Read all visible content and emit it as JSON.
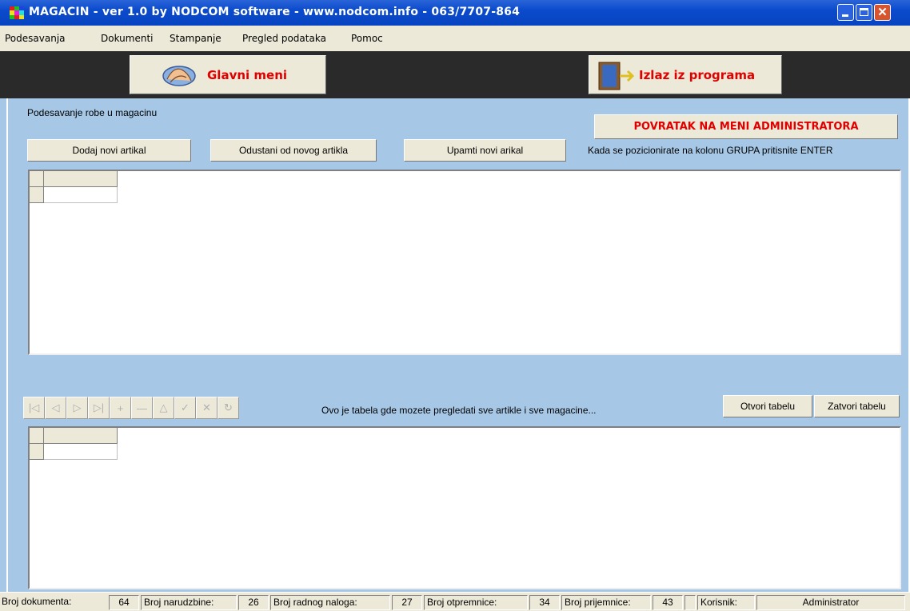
{
  "window": {
    "title": "MAGACIN - ver 1.0 by NODCOM software - www.nodcom.info - 063/7707-864",
    "close_glyph": "✕"
  },
  "menu": {
    "items": [
      "Podesavanja",
      "Dokumenti",
      "Stampanje",
      "Pregled podataka",
      "Pomoc"
    ]
  },
  "toolbar": {
    "main_menu_label": "Glavni meni",
    "exit_label": "Izlaz iz programa",
    "main_menu_icon": "hands-icon",
    "exit_icon": "door-exit-icon"
  },
  "content": {
    "section_title": "Podesavanje robe u magacinu",
    "back_to_admin_label": "POVRATAK NA MENI ADMINISTRATORA",
    "add_article_label": "Dodaj novi artikal",
    "cancel_article_label": "Odustani od novog artikla",
    "save_article_label": "Upamti novi arikal",
    "hint_text": "Kada se pozicionirate na kolonu GRUPA pritisnite ENTER",
    "table_info_text": "Ovo je tabela gde mozete pregledati sve artikle i sve magacine...",
    "open_table_label": "Otvori tabelu",
    "close_table_label": "Zatvori tabelu"
  },
  "navigator": {
    "buttons": [
      {
        "name": "first-record-button",
        "glyph": "|◁"
      },
      {
        "name": "prior-record-button",
        "glyph": "◁"
      },
      {
        "name": "next-record-button",
        "glyph": "▷"
      },
      {
        "name": "last-record-button",
        "glyph": "▷|"
      },
      {
        "name": "insert-record-button",
        "glyph": "+"
      },
      {
        "name": "delete-record-button",
        "glyph": "—"
      },
      {
        "name": "edit-record-button",
        "glyph": "△"
      },
      {
        "name": "post-record-button",
        "glyph": "✓"
      },
      {
        "name": "cancel-record-button",
        "glyph": "✕"
      },
      {
        "name": "refresh-record-button",
        "glyph": "↻"
      }
    ]
  },
  "status": {
    "broj_dokumenta_label": "Broj dokumenta:",
    "broj_dokumenta_value": "64",
    "broj_narudzbine_label": "Broj narudzbine:",
    "broj_narudzbine_value": "26",
    "broj_radnog_naloga_label": "Broj radnog naloga:",
    "broj_radnog_naloga_value": "27",
    "broj_otpremnice_label": "Broj otpremnice:",
    "broj_otpremnice_value": "34",
    "broj_prijemnice_label": "Broj prijemnice:",
    "broj_prijemnice_value": "43",
    "korisnik_label": "Korisnik:",
    "korisnik_value": "Administrator"
  },
  "colors": {
    "accent_red": "#e00000",
    "background_blue": "#a6c8e6",
    "titlebar_blue": "#0a4acc"
  }
}
